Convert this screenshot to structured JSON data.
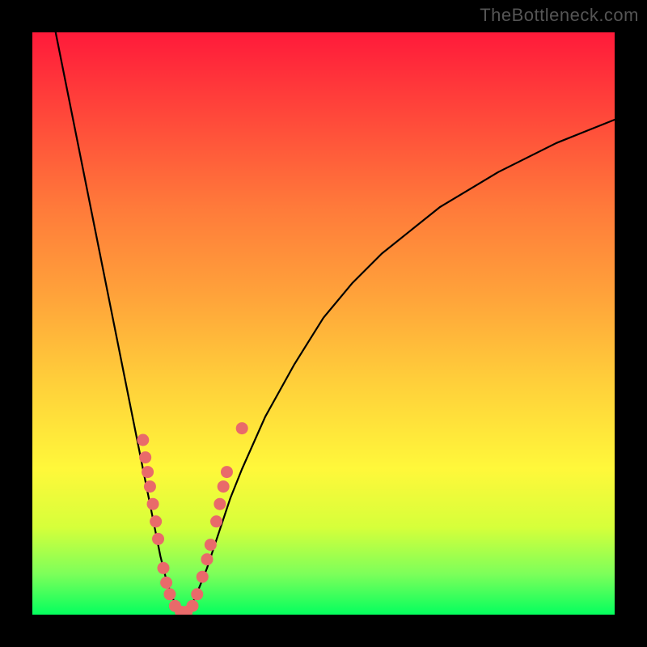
{
  "watermark": "TheBottleneck.com",
  "chart_data": {
    "type": "line",
    "title": "",
    "xlabel": "",
    "ylabel": "",
    "xlim": [
      0,
      100
    ],
    "ylim": [
      0,
      100
    ],
    "series": [
      {
        "name": "left-branch",
        "x": [
          4,
          6,
          8,
          10,
          12,
          14,
          16,
          18,
          20,
          21,
          22,
          23,
          24,
          25,
          26
        ],
        "y": [
          100,
          90,
          80,
          70,
          60,
          50,
          40,
          30,
          20,
          15,
          10,
          6,
          3,
          1,
          0
        ]
      },
      {
        "name": "right-branch",
        "x": [
          26,
          27,
          28,
          30,
          32,
          34,
          36,
          40,
          45,
          50,
          55,
          60,
          65,
          70,
          75,
          80,
          85,
          90,
          95,
          100
        ],
        "y": [
          0,
          1,
          3,
          8,
          14,
          20,
          25,
          34,
          43,
          51,
          57,
          62,
          66,
          70,
          73,
          76,
          78.5,
          81,
          83,
          85
        ]
      }
    ],
    "markers": [
      {
        "x": 19.0,
        "y": 30
      },
      {
        "x": 19.4,
        "y": 27
      },
      {
        "x": 19.8,
        "y": 24.5
      },
      {
        "x": 20.2,
        "y": 22
      },
      {
        "x": 20.7,
        "y": 19
      },
      {
        "x": 21.2,
        "y": 16
      },
      {
        "x": 21.6,
        "y": 13
      },
      {
        "x": 22.5,
        "y": 8
      },
      {
        "x": 23.0,
        "y": 5.5
      },
      {
        "x": 23.6,
        "y": 3.5
      },
      {
        "x": 24.5,
        "y": 1.5
      },
      {
        "x": 25.5,
        "y": 0.5
      },
      {
        "x": 26.5,
        "y": 0.5
      },
      {
        "x": 27.5,
        "y": 1.5
      },
      {
        "x": 28.3,
        "y": 3.5
      },
      {
        "x": 29.2,
        "y": 6.5
      },
      {
        "x": 30.0,
        "y": 9.5
      },
      {
        "x": 30.6,
        "y": 12
      },
      {
        "x": 31.6,
        "y": 16
      },
      {
        "x": 32.2,
        "y": 19
      },
      {
        "x": 32.8,
        "y": 22
      },
      {
        "x": 33.4,
        "y": 24.5
      },
      {
        "x": 36.0,
        "y": 32
      }
    ],
    "marker_color": "#e96a6a",
    "curve_color": "#000000"
  }
}
